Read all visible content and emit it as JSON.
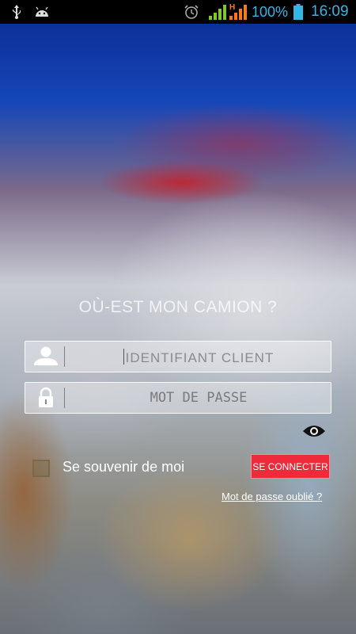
{
  "status_bar": {
    "battery_percent": "100%",
    "time": "16:09",
    "signal_2_label": "H",
    "icons": [
      "usb-icon",
      "android-icon",
      "alarm-icon",
      "signal-icon",
      "signal-h-icon",
      "battery-icon"
    ],
    "accent_color": "#33b5e5"
  },
  "login": {
    "title": "OÙ-EST MON CAMION ?",
    "username_placeholder": "IDENTIFIANT CLIENT",
    "password_placeholder": "MOT DE PASSE",
    "remember_label": "Se souvenir de moi",
    "remember_checked": false,
    "connect_label": "SE CONNECTER",
    "forgot_label": "Mot de passe oublié ?",
    "connect_color": "#ef2b3b"
  }
}
